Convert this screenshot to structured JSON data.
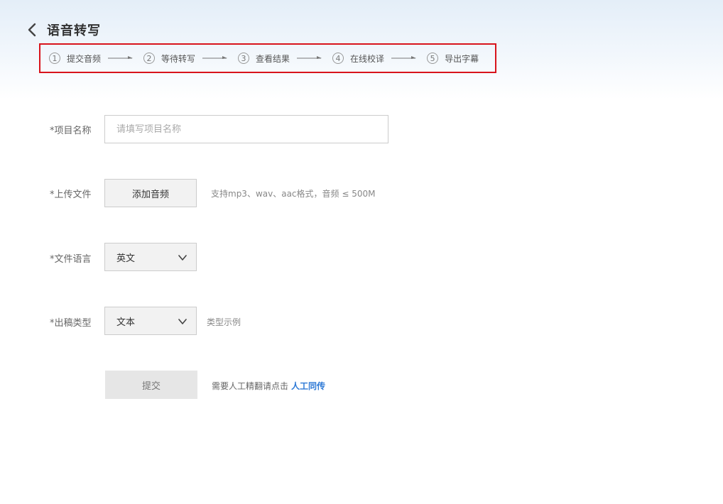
{
  "header": {
    "title": "语音转写"
  },
  "steps": [
    {
      "num": "1",
      "label": "提交音频"
    },
    {
      "num": "2",
      "label": "等待转写"
    },
    {
      "num": "3",
      "label": "查看结果"
    },
    {
      "num": "4",
      "label": "在线校译"
    },
    {
      "num": "5",
      "label": "导出字幕"
    }
  ],
  "form": {
    "project_name": {
      "label": "*项目名称",
      "placeholder": "请填写项目名称",
      "value": ""
    },
    "upload": {
      "label": "*上传文件",
      "button": "添加音频",
      "hint": "支持mp3、wav、aac格式，音频 ≤ 500M"
    },
    "language": {
      "label": "*文件语言",
      "value": "英文"
    },
    "output_type": {
      "label": "*出稿类型",
      "value": "文本",
      "example_link": "类型示例"
    },
    "submit": {
      "label": "提交",
      "note": "需要人工精翻请点击",
      "link": "人工同传"
    }
  },
  "colors": {
    "highlight_border": "#d8141c",
    "link": "#2f7ad6",
    "header_gradient_top": "#e4eef8"
  }
}
